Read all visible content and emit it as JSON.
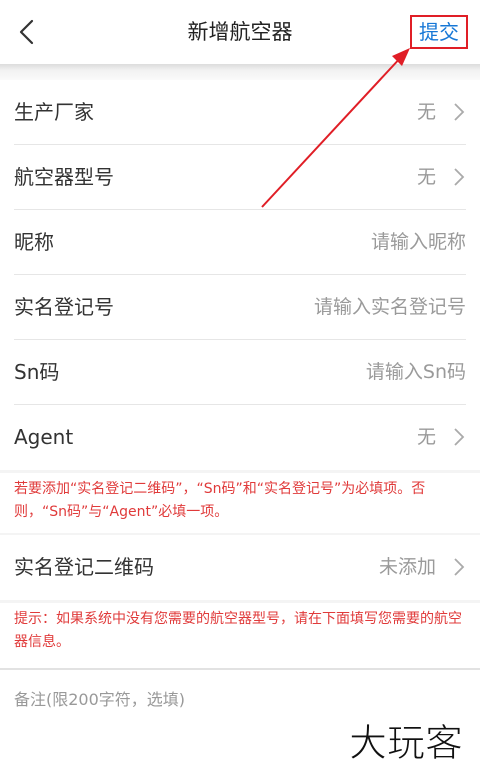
{
  "header": {
    "title": "新增航空器",
    "submit_label": "提交"
  },
  "rows": [
    {
      "label": "生产厂家",
      "value": "无"
    },
    {
      "label": "航空器型号",
      "value": "无"
    },
    {
      "label": "昵称",
      "placeholder": "请输入昵称"
    },
    {
      "label": "实名登记号",
      "placeholder": "请输入实名登记号"
    },
    {
      "label": "Sn码",
      "placeholder": "请输入Sn码"
    },
    {
      "label": "Agent",
      "value": "无"
    }
  ],
  "notice1": "若要添加“实名登记二维码”，“Sn码”和“实名登记号”为必填项。否则，“Sn码”与“Agent”必填一项。",
  "qr_row": {
    "label": "实名登记二维码",
    "value": "未添加"
  },
  "notice2": "提示：如果系统中没有您需要的航空器型号，请在下面填写您需要的航空器信息。",
  "remarks_placeholder": "备注(限200字符，选填)",
  "watermark": "大玩客",
  "colors": {
    "link_blue": "#1677d6",
    "warning_red": "#e03a3a",
    "annotation_red": "#e01e26",
    "muted_gray": "#9a9a9a"
  },
  "icons": [
    "back-arrow-icon",
    "chevron-right-icon"
  ]
}
